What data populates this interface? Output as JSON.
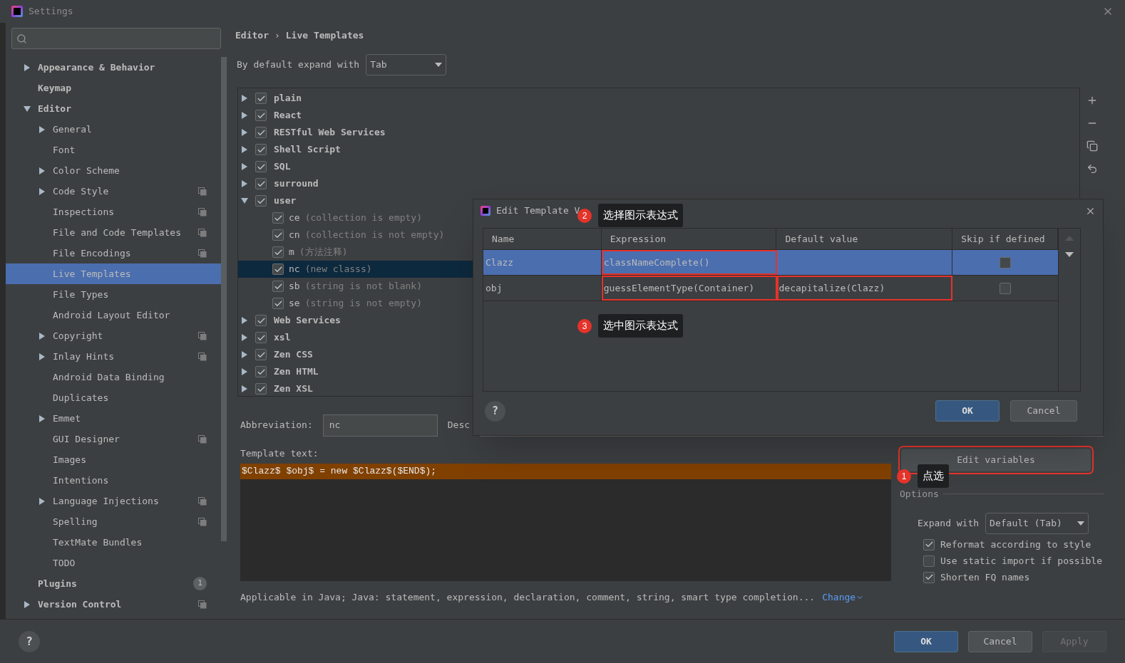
{
  "window": {
    "title": "Settings"
  },
  "sidebar": {
    "items": [
      {
        "label": "Appearance & Behavior",
        "expanded": false,
        "selected": false,
        "project": false
      },
      {
        "label": "Keymap",
        "selected": false,
        "project": false
      },
      {
        "label": "Editor",
        "expanded": true,
        "selected": false,
        "project": false,
        "children": [
          {
            "label": "General",
            "expanded": false,
            "selected": false,
            "project": false
          },
          {
            "label": "Font",
            "selected": false,
            "project": false
          },
          {
            "label": "Color Scheme",
            "expanded": false,
            "selected": false,
            "project": false
          },
          {
            "label": "Code Style",
            "expanded": false,
            "selected": false,
            "project": true
          },
          {
            "label": "Inspections",
            "selected": false,
            "project": true
          },
          {
            "label": "File and Code Templates",
            "selected": false,
            "project": true
          },
          {
            "label": "File Encodings",
            "selected": false,
            "project": true
          },
          {
            "label": "Live Templates",
            "selected": true,
            "project": false
          },
          {
            "label": "File Types",
            "selected": false,
            "project": false
          },
          {
            "label": "Android Layout Editor",
            "selected": false,
            "project": false
          },
          {
            "label": "Copyright",
            "expanded": false,
            "selected": false,
            "project": true
          },
          {
            "label": "Inlay Hints",
            "expanded": false,
            "selected": false,
            "project": true
          },
          {
            "label": "Android Data Binding",
            "selected": false,
            "project": false
          },
          {
            "label": "Duplicates",
            "selected": false,
            "project": false
          },
          {
            "label": "Emmet",
            "expanded": false,
            "selected": false,
            "project": false
          },
          {
            "label": "GUI Designer",
            "selected": false,
            "project": true
          },
          {
            "label": "Images",
            "selected": false,
            "project": false
          },
          {
            "label": "Intentions",
            "selected": false,
            "project": false
          },
          {
            "label": "Language Injections",
            "expanded": false,
            "selected": false,
            "project": true
          },
          {
            "label": "Spelling",
            "selected": false,
            "project": true
          },
          {
            "label": "TextMate Bundles",
            "selected": false,
            "project": false
          },
          {
            "label": "TODO",
            "selected": false,
            "project": false
          }
        ]
      },
      {
        "label": "Plugins",
        "selected": false,
        "project": false,
        "badge": "1"
      },
      {
        "label": "Version Control",
        "expanded": false,
        "selected": false,
        "project": true
      }
    ]
  },
  "breadcrumb": [
    "Editor",
    "›",
    "Live Templates"
  ],
  "expand_default": {
    "label": "By default expand with",
    "value": "Tab"
  },
  "tree": {
    "groups": [
      {
        "label": "plain",
        "checked": true,
        "expanded": false
      },
      {
        "label": "React",
        "checked": true,
        "expanded": false
      },
      {
        "label": "RESTful Web Services",
        "checked": true,
        "expanded": false
      },
      {
        "label": "Shell Script",
        "checked": true,
        "expanded": false
      },
      {
        "label": "SQL",
        "checked": true,
        "expanded": false
      },
      {
        "label": "surround",
        "checked": true,
        "expanded": false
      },
      {
        "label": "user",
        "checked": true,
        "expanded": true,
        "children": [
          {
            "abbreviation": "ce",
            "description": "(collection is empty)",
            "checked": true,
            "selected": false
          },
          {
            "abbreviation": "cn",
            "description": "(collection is not empty)",
            "checked": true,
            "selected": false
          },
          {
            "abbreviation": "m",
            "description": "(方法注释)",
            "checked": true,
            "selected": false
          },
          {
            "abbreviation": "nc",
            "description": "(new classs)",
            "checked": true,
            "selected": true
          },
          {
            "abbreviation": "sb",
            "description": "(string is not blank)",
            "checked": true,
            "selected": false
          },
          {
            "abbreviation": "se",
            "description": "(string is not empty)",
            "checked": true,
            "selected": false
          }
        ]
      },
      {
        "label": "Web Services",
        "checked": true,
        "expanded": false
      },
      {
        "label": "xsl",
        "checked": true,
        "expanded": false
      },
      {
        "label": "Zen CSS",
        "checked": true,
        "expanded": false
      },
      {
        "label": "Zen HTML",
        "checked": true,
        "expanded": false
      },
      {
        "label": "Zen XSL",
        "checked": true,
        "expanded": false
      }
    ]
  },
  "abbreviation": {
    "label": "Abbreviation:",
    "value": "nc"
  },
  "description_label": "Desc",
  "template_text": {
    "label": "Template text:",
    "value": "$Clazz$ $obj$ = new $Clazz$($END$);"
  },
  "applicable": {
    "text": "Applicable in Java; Java: statement, expression, declaration, comment, string, smart type completion...",
    "link": "Change"
  },
  "edit_variables": {
    "label": "Edit variables",
    "marked": true
  },
  "options": {
    "label": "Options",
    "expand_label": "Expand with",
    "expand_value": "Default (Tab)",
    "checks": [
      {
        "label": "Reformat according to style",
        "checked": true
      },
      {
        "label": "Use static import if possible",
        "checked": false
      },
      {
        "label": "Shorten FQ names",
        "checked": true
      }
    ]
  },
  "dialog": {
    "title": "Edit Template V",
    "columns": [
      "Name",
      "Expression",
      "Default value",
      "Skip if defined"
    ],
    "rows": [
      {
        "name": "Clazz",
        "expression": "classNameComplete()",
        "skip_if_defined": false,
        "selected": true,
        "expression_marked": true,
        "default_marked": false
      },
      {
        "name": "obj",
        "expression": "guessElementType(Container)",
        "default_value": "decapitalize(Clazz)",
        "skip_if_defined": false,
        "selected": false,
        "expression_marked": true,
        "default_marked": true
      }
    ],
    "help": "?",
    "buttons": [
      "OK",
      "Cancel"
    ]
  },
  "callouts": [
    {
      "number": "2",
      "text": "选择图示表达式"
    },
    {
      "number": "3",
      "text": "选中图示表达式"
    },
    {
      "number": "1",
      "text": "点选"
    }
  ],
  "help": "?",
  "footer_buttons": [
    {
      "label": "OK",
      "kind": "primary",
      "disabled": false
    },
    {
      "label": "Cancel",
      "kind": "normal",
      "disabled": false
    },
    {
      "label": "Apply",
      "kind": "normal",
      "disabled": true
    }
  ]
}
